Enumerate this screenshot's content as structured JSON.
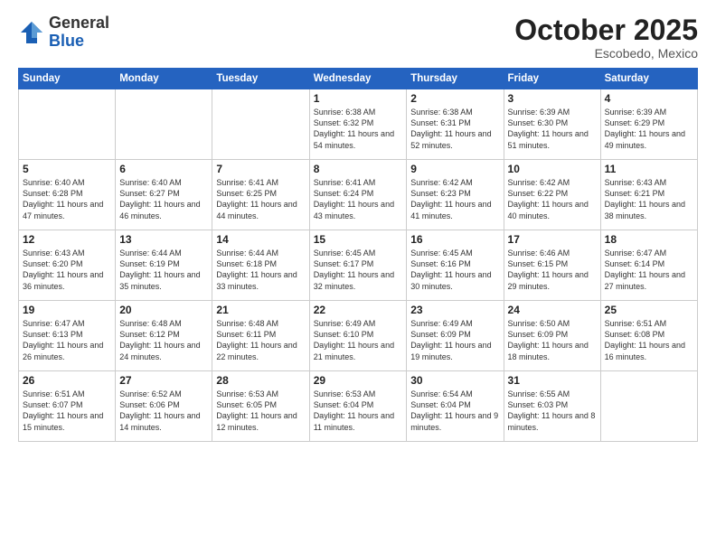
{
  "logo": {
    "general": "General",
    "blue": "Blue"
  },
  "header": {
    "month": "October 2025",
    "location": "Escobedo, Mexico"
  },
  "weekdays": [
    "Sunday",
    "Monday",
    "Tuesday",
    "Wednesday",
    "Thursday",
    "Friday",
    "Saturday"
  ],
  "weeks": [
    [
      {
        "day": "",
        "info": ""
      },
      {
        "day": "",
        "info": ""
      },
      {
        "day": "",
        "info": ""
      },
      {
        "day": "1",
        "info": "Sunrise: 6:38 AM\nSunset: 6:32 PM\nDaylight: 11 hours\nand 54 minutes."
      },
      {
        "day": "2",
        "info": "Sunrise: 6:38 AM\nSunset: 6:31 PM\nDaylight: 11 hours\nand 52 minutes."
      },
      {
        "day": "3",
        "info": "Sunrise: 6:39 AM\nSunset: 6:30 PM\nDaylight: 11 hours\nand 51 minutes."
      },
      {
        "day": "4",
        "info": "Sunrise: 6:39 AM\nSunset: 6:29 PM\nDaylight: 11 hours\nand 49 minutes."
      }
    ],
    [
      {
        "day": "5",
        "info": "Sunrise: 6:40 AM\nSunset: 6:28 PM\nDaylight: 11 hours\nand 47 minutes."
      },
      {
        "day": "6",
        "info": "Sunrise: 6:40 AM\nSunset: 6:27 PM\nDaylight: 11 hours\nand 46 minutes."
      },
      {
        "day": "7",
        "info": "Sunrise: 6:41 AM\nSunset: 6:25 PM\nDaylight: 11 hours\nand 44 minutes."
      },
      {
        "day": "8",
        "info": "Sunrise: 6:41 AM\nSunset: 6:24 PM\nDaylight: 11 hours\nand 43 minutes."
      },
      {
        "day": "9",
        "info": "Sunrise: 6:42 AM\nSunset: 6:23 PM\nDaylight: 11 hours\nand 41 minutes."
      },
      {
        "day": "10",
        "info": "Sunrise: 6:42 AM\nSunset: 6:22 PM\nDaylight: 11 hours\nand 40 minutes."
      },
      {
        "day": "11",
        "info": "Sunrise: 6:43 AM\nSunset: 6:21 PM\nDaylight: 11 hours\nand 38 minutes."
      }
    ],
    [
      {
        "day": "12",
        "info": "Sunrise: 6:43 AM\nSunset: 6:20 PM\nDaylight: 11 hours\nand 36 minutes."
      },
      {
        "day": "13",
        "info": "Sunrise: 6:44 AM\nSunset: 6:19 PM\nDaylight: 11 hours\nand 35 minutes."
      },
      {
        "day": "14",
        "info": "Sunrise: 6:44 AM\nSunset: 6:18 PM\nDaylight: 11 hours\nand 33 minutes."
      },
      {
        "day": "15",
        "info": "Sunrise: 6:45 AM\nSunset: 6:17 PM\nDaylight: 11 hours\nand 32 minutes."
      },
      {
        "day": "16",
        "info": "Sunrise: 6:45 AM\nSunset: 6:16 PM\nDaylight: 11 hours\nand 30 minutes."
      },
      {
        "day": "17",
        "info": "Sunrise: 6:46 AM\nSunset: 6:15 PM\nDaylight: 11 hours\nand 29 minutes."
      },
      {
        "day": "18",
        "info": "Sunrise: 6:47 AM\nSunset: 6:14 PM\nDaylight: 11 hours\nand 27 minutes."
      }
    ],
    [
      {
        "day": "19",
        "info": "Sunrise: 6:47 AM\nSunset: 6:13 PM\nDaylight: 11 hours\nand 26 minutes."
      },
      {
        "day": "20",
        "info": "Sunrise: 6:48 AM\nSunset: 6:12 PM\nDaylight: 11 hours\nand 24 minutes."
      },
      {
        "day": "21",
        "info": "Sunrise: 6:48 AM\nSunset: 6:11 PM\nDaylight: 11 hours\nand 22 minutes."
      },
      {
        "day": "22",
        "info": "Sunrise: 6:49 AM\nSunset: 6:10 PM\nDaylight: 11 hours\nand 21 minutes."
      },
      {
        "day": "23",
        "info": "Sunrise: 6:49 AM\nSunset: 6:09 PM\nDaylight: 11 hours\nand 19 minutes."
      },
      {
        "day": "24",
        "info": "Sunrise: 6:50 AM\nSunset: 6:09 PM\nDaylight: 11 hours\nand 18 minutes."
      },
      {
        "day": "25",
        "info": "Sunrise: 6:51 AM\nSunset: 6:08 PM\nDaylight: 11 hours\nand 16 minutes."
      }
    ],
    [
      {
        "day": "26",
        "info": "Sunrise: 6:51 AM\nSunset: 6:07 PM\nDaylight: 11 hours\nand 15 minutes."
      },
      {
        "day": "27",
        "info": "Sunrise: 6:52 AM\nSunset: 6:06 PM\nDaylight: 11 hours\nand 14 minutes."
      },
      {
        "day": "28",
        "info": "Sunrise: 6:53 AM\nSunset: 6:05 PM\nDaylight: 11 hours\nand 12 minutes."
      },
      {
        "day": "29",
        "info": "Sunrise: 6:53 AM\nSunset: 6:04 PM\nDaylight: 11 hours\nand 11 minutes."
      },
      {
        "day": "30",
        "info": "Sunrise: 6:54 AM\nSunset: 6:04 PM\nDaylight: 11 hours\nand 9 minutes."
      },
      {
        "day": "31",
        "info": "Sunrise: 6:55 AM\nSunset: 6:03 PM\nDaylight: 11 hours\nand 8 minutes."
      },
      {
        "day": "",
        "info": ""
      }
    ]
  ]
}
